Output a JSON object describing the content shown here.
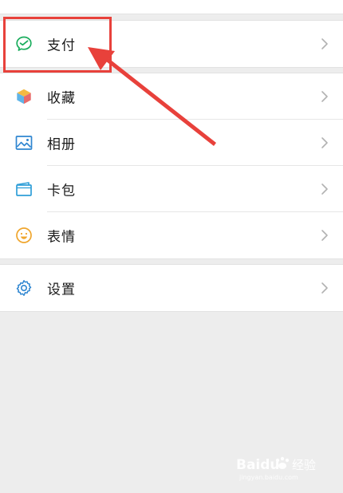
{
  "menu": {
    "items": [
      {
        "label": "支付"
      },
      {
        "label": "收藏"
      },
      {
        "label": "相册"
      },
      {
        "label": "卡包"
      },
      {
        "label": "表情"
      },
      {
        "label": "设置"
      }
    ]
  },
  "icons": {
    "pay": "pay-icon",
    "favorites": "cube-icon",
    "album": "picture-icon",
    "cards": "card-wallet-icon",
    "sticker": "smiley-icon",
    "settings": "gear-icon",
    "chevron": "chevron-right-icon"
  },
  "colors": {
    "pay_green": "#1aad5d",
    "annotation_red": "#e8413b",
    "background": "#ededed"
  },
  "watermark": {
    "brand": "Baidu",
    "suffix": "经验",
    "url": "jingyan.baidu.com"
  }
}
